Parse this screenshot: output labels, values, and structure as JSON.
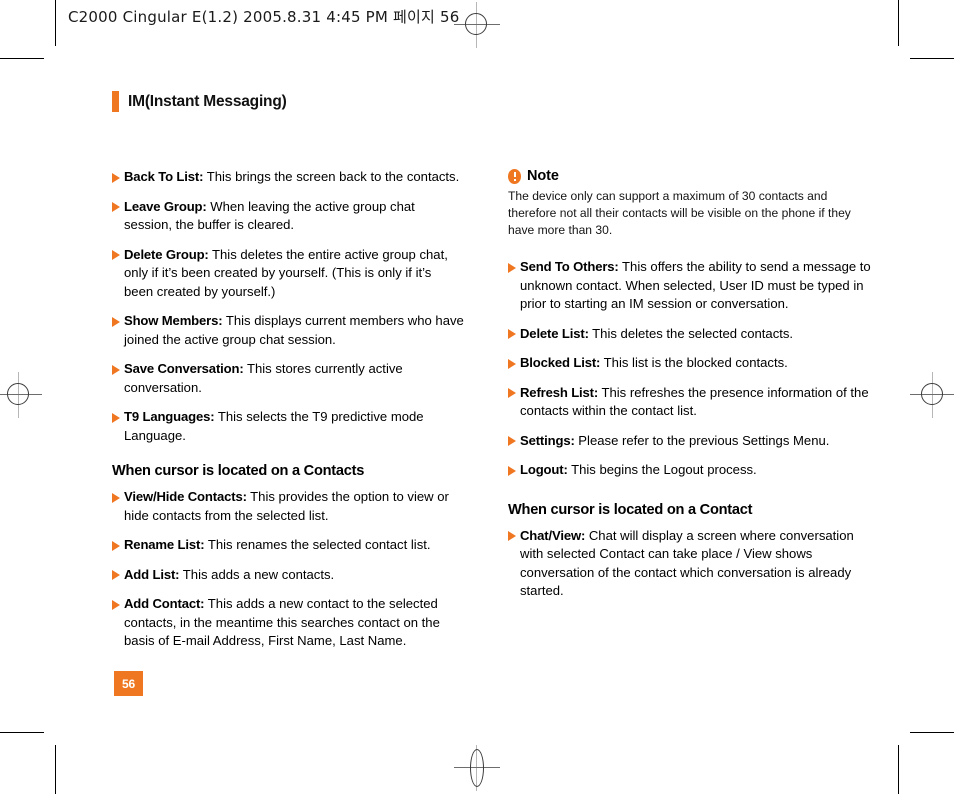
{
  "header": {
    "running_text": "C2000 Cingular  E(1.2)  2005.8.31 4:45 PM 페이지 56"
  },
  "chapter": {
    "title": "IM(Instant Messaging)",
    "accent_color": "#F07721"
  },
  "left_column": {
    "items": [
      {
        "term": "Back To List:",
        "desc": " This brings the screen back to the contacts."
      },
      {
        "term": "Leave Group:",
        "desc": " When leaving the active group chat session, the buffer is cleared."
      },
      {
        "term": "Delete Group:",
        "desc": " This deletes the entire active group chat, only if it’s been created by yourself. (This is only if it’s been created by yourself.)"
      },
      {
        "term": "Show Members:",
        "desc": " This displays current members who have joined the active group chat session."
      },
      {
        "term": "Save Conversation:",
        "desc": " This stores currently active conversation."
      },
      {
        "term": "T9 Languages:",
        "desc": " This selects the T9 predictive mode Language."
      }
    ],
    "section_heading": "When cursor is located on a Contacts",
    "section_items": [
      {
        "term": "View/Hide Contacts:",
        "desc": " This provides the option to view or hide contacts from the selected list."
      },
      {
        "term": "Rename List:",
        "desc": " This renames the selected contact list."
      },
      {
        "term": "Add List:",
        "desc": " This adds a new contacts."
      },
      {
        "term": "Add Contact:",
        "desc": " This adds a new contact to the selected contacts, in the meantime this searches contact on the basis of E-mail Address, First Name, Last Name."
      }
    ]
  },
  "right_column": {
    "note": {
      "title": "Note",
      "body": "The device only can support a maximum of 30 contacts and therefore not all their contacts will be visible on the phone if they have more than 30."
    },
    "items": [
      {
        "term": "Send To Others:",
        "desc": " This offers the ability to send a message to unknown contact. When selected, User ID must be typed in prior to starting an IM session or conversation."
      },
      {
        "term": "Delete List:",
        "desc": " This deletes the selected contacts."
      },
      {
        "term": "Blocked List:",
        "desc": " This list is the blocked contacts."
      },
      {
        "term": "Refresh List:",
        "desc": " This refreshes the presence information of the contacts within the contact list."
      },
      {
        "term": "Settings:",
        "desc": " Please refer to the previous Settings Menu."
      },
      {
        "term": "Logout:",
        "desc": " This begins the Logout process."
      }
    ],
    "section_heading": "When cursor is located on a Contact",
    "section_items": [
      {
        "term": "Chat/View:",
        "desc": " Chat will display a screen where conversation with selected Contact can take place / View shows conversation of the contact which conversation is already started."
      }
    ]
  },
  "footer": {
    "page_number": "56"
  }
}
